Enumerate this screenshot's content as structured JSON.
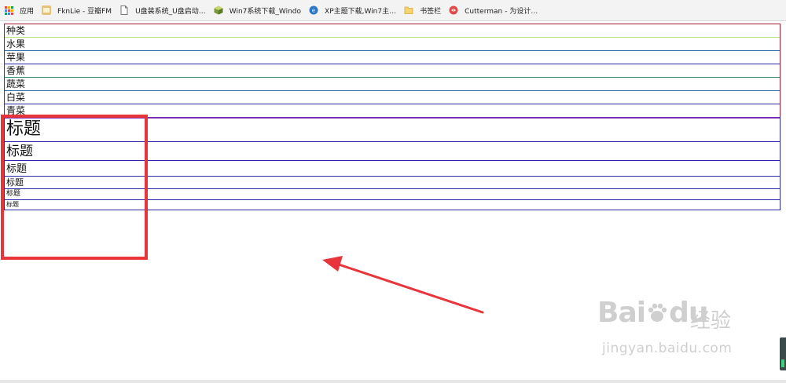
{
  "bookmarks": {
    "items": [
      {
        "label": "应用",
        "icon": "apps-grid-icon"
      },
      {
        "label": "FknLie - 豆瓣FM",
        "icon": "douban-fm-icon"
      },
      {
        "label": "U盘装系统_U盘启动…",
        "icon": "document-icon"
      },
      {
        "label": "Win7系统下载_Windo",
        "icon": "win7-cube-icon"
      },
      {
        "label": "XP主题下载,Win7主…",
        "icon": "xp-globe-icon"
      },
      {
        "label": "书签栏",
        "icon": "folder-icon"
      },
      {
        "label": "Cutterman - 为设计…",
        "icon": "cutterman-icon"
      }
    ]
  },
  "list": {
    "items": [
      "种类",
      "水果",
      "苹果",
      "香蕉",
      "蔬菜",
      "白菜",
      "青菜"
    ]
  },
  "headings": {
    "h1": "标题",
    "h2": "标题",
    "h3": "标题",
    "h4": "标题",
    "h5": "标题",
    "h6": "标题"
  },
  "watermark": {
    "logo": "Bai",
    "logo_tail": "du",
    "cn": "经验",
    "url": "jingyan.baidu.com"
  },
  "colors": {
    "annotation": "#e8353b",
    "list_border": "#a01c30",
    "row_border": "#2a2aa8",
    "bookmark_bar_bg": "#f3f3f3"
  }
}
